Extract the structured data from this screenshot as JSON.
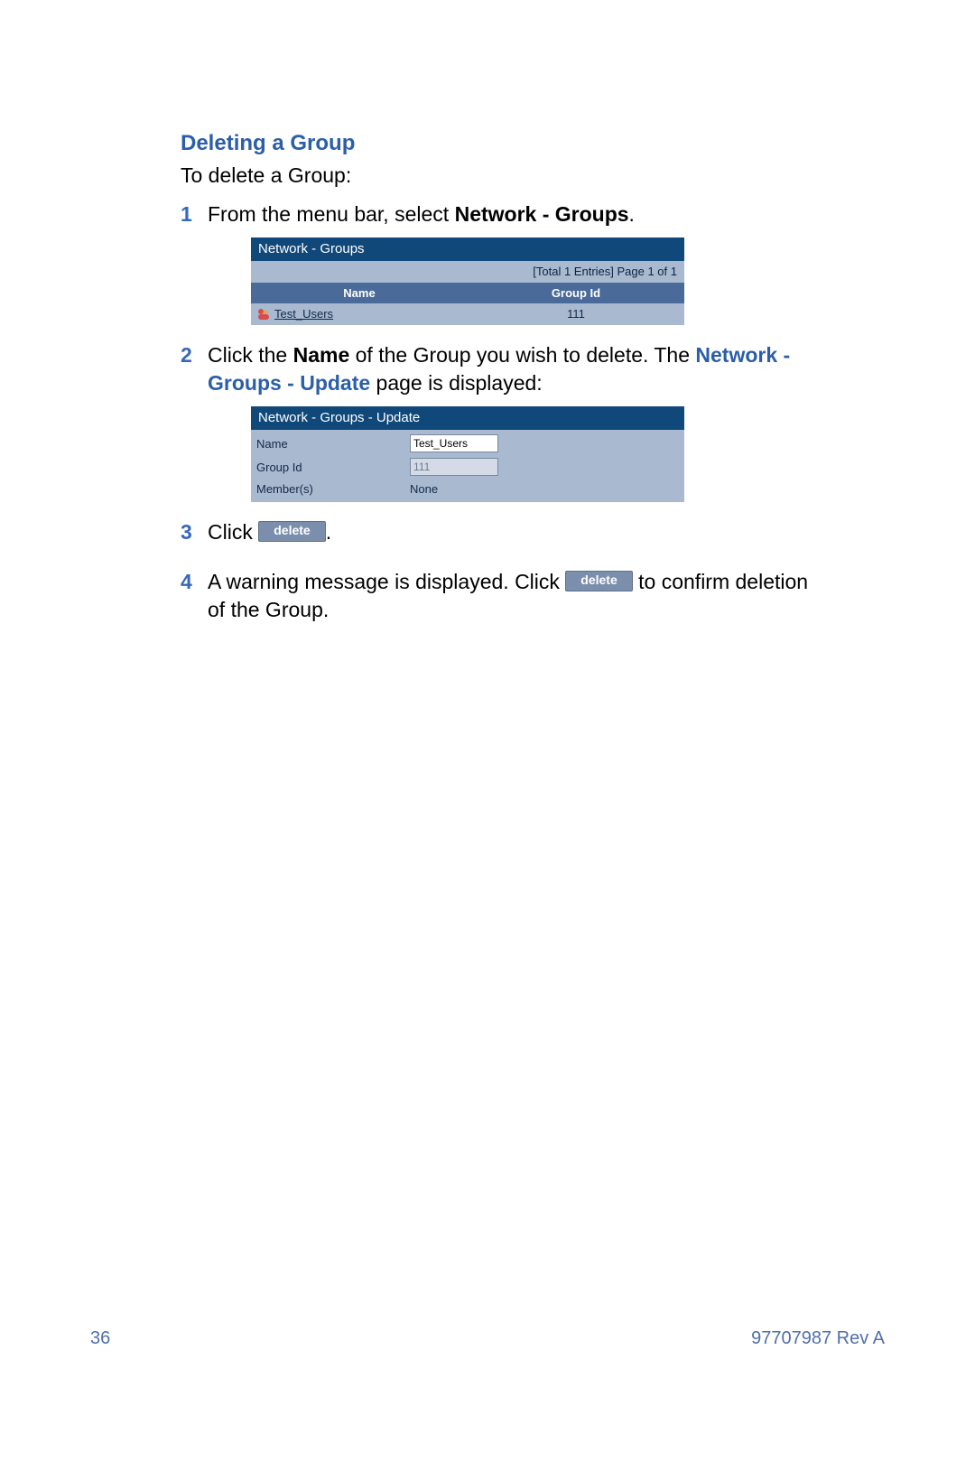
{
  "section_title": "Deleting a Group",
  "intro": "To delete a Group:",
  "steps": {
    "s1": {
      "num": "1",
      "pre": "From the menu bar, select ",
      "bold": "Network - Groups",
      "post": "."
    },
    "s2": {
      "num": "2",
      "pre": "Click the ",
      "bold1": "Name",
      "mid": " of the Group you wish to delete. The ",
      "bold2": "Network - Groups - Update",
      "post": " page is displayed:"
    },
    "s3": {
      "num": "3",
      "pre": "Click ",
      "btn": "delete",
      "post": "."
    },
    "s4": {
      "num": "4",
      "pre": "A warning message is displayed. Click ",
      "btn": "delete",
      "post": " to confirm deletion of the Group."
    }
  },
  "panel1": {
    "title": "Network - Groups",
    "pager": "[Total 1 Entries] Page 1 of 1",
    "head_name": "Name",
    "head_id": "Group Id",
    "row_name": "Test_Users",
    "row_id": "111"
  },
  "panel2": {
    "title": "Network - Groups - Update",
    "lbl_name": "Name",
    "val_name": "Test_Users",
    "lbl_id": "Group Id",
    "val_id": "111",
    "lbl_members": "Member(s)",
    "val_members": "None"
  },
  "footer": {
    "page_num": "36",
    "rev": "97707987 Rev A"
  }
}
